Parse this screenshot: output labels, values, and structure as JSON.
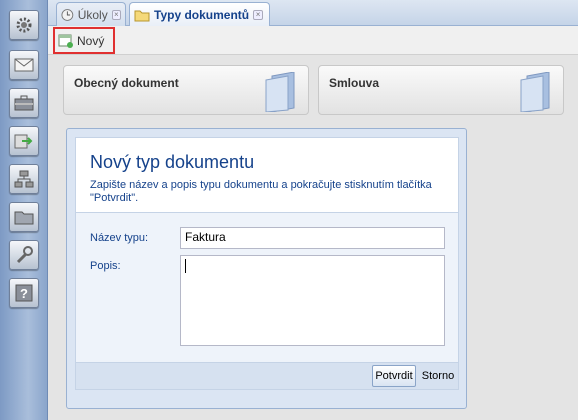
{
  "tabs": [
    {
      "label": "Úkoly",
      "icon": "clock-icon",
      "active": false
    },
    {
      "label": "Typy dokumentů",
      "icon": "folder-icon",
      "active": true
    }
  ],
  "toolbar": {
    "new_label": "Nový"
  },
  "sidebar": {
    "items": [
      {
        "icon": "gear-icon"
      },
      {
        "icon": "mail-icon"
      },
      {
        "icon": "briefcase-icon"
      },
      {
        "icon": "arrow-right-icon"
      },
      {
        "icon": "network-icon"
      },
      {
        "icon": "folder-icon"
      },
      {
        "icon": "wrench-icon"
      },
      {
        "icon": "help-icon"
      }
    ]
  },
  "document_types": [
    {
      "label": "Obecný dokument"
    },
    {
      "label": "Smlouva"
    }
  ],
  "dialog": {
    "title": "Nový typ dokumentu",
    "description": "Zapište název a popis typu dokumentu a pokračujte stisknutím tlačítka \"Potvrdit\".",
    "name_label": "Název typu:",
    "name_value": "Faktura",
    "description_label": "Popis:",
    "description_value": "",
    "confirm_label": "Potvrdit",
    "cancel_label": "Storno"
  },
  "colors": {
    "accent": "#15428b",
    "highlight": "#e03030"
  }
}
